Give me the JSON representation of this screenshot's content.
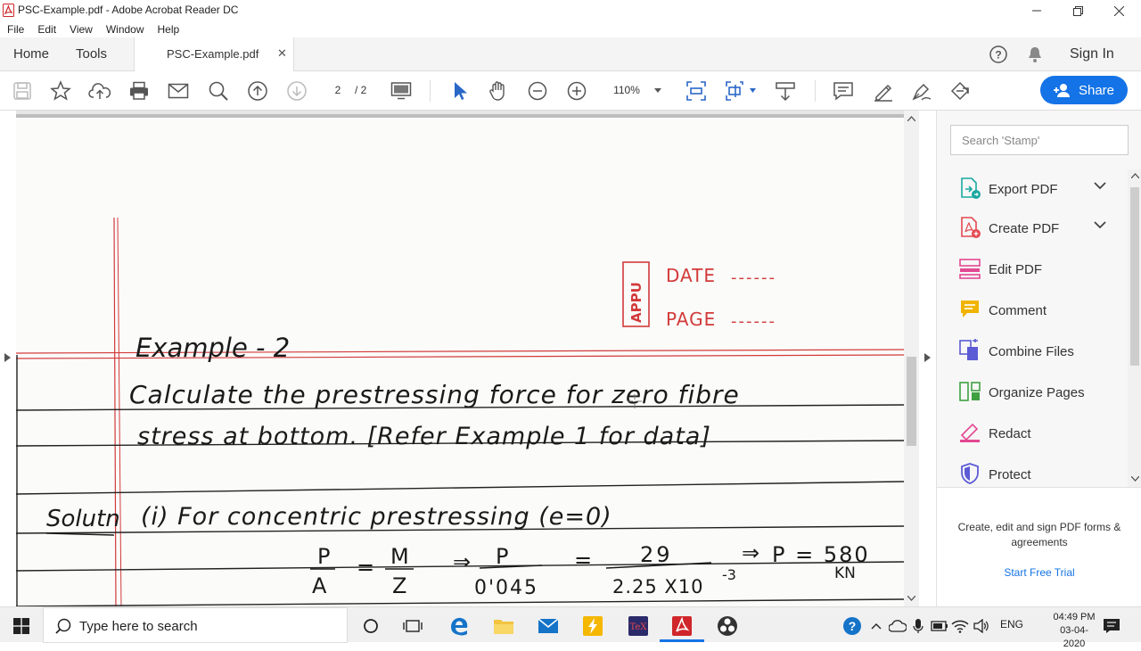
{
  "window": {
    "title": "PSC-Example.pdf - Adobe Acrobat Reader DC"
  },
  "menu": [
    "File",
    "Edit",
    "View",
    "Window",
    "Help"
  ],
  "tabs": {
    "home": "Home",
    "tools": "Tools",
    "document": "PSC-Example.pdf",
    "sign_in": "Sign In"
  },
  "toolbar": {
    "current_page": "2",
    "total_pages": "/ 2",
    "zoom": "110%",
    "share_label": "Share"
  },
  "document": {
    "stamp": {
      "brand": "APPU",
      "date_label": "DATE",
      "date_blank": "------",
      "page_label": "PAGE",
      "page_blank": "------"
    },
    "heading": "Example - 2",
    "line1": "Calculate the prestressing force for zero fibre",
    "line2": "stress at bottom. [Refer Example 1 for data]",
    "solution_label": "Solutn",
    "solution_text": "(i) For concentric prestressing (e=0)",
    "eq": {
      "lhs_num": "P",
      "lhs_den": "A",
      "eq1": "=",
      "m_num": "M",
      "m_den": "Z",
      "implies1": "⇒",
      "p_num": "P",
      "p_den": "0'045",
      "eq2": "=",
      "r_num": "29",
      "r_den": "2.25 X10",
      "r_exp": "-3",
      "implies2": "⇒",
      "result": "P = 580",
      "unit": "KN"
    }
  },
  "right_panel": {
    "search_placeholder": "Search 'Stamp'",
    "tools": [
      {
        "label": "Export PDF",
        "icon": "export-pdf-icon",
        "color": "#1aa8a0"
      },
      {
        "label": "Create PDF",
        "icon": "create-pdf-icon",
        "color": "#e34850"
      },
      {
        "label": "Edit PDF",
        "icon": "edit-pdf-icon",
        "color": "#e34892"
      },
      {
        "label": "Comment",
        "icon": "comment-icon",
        "color": "#f0b400"
      },
      {
        "label": "Combine Files",
        "icon": "combine-files-icon",
        "color": "#5b5bd6"
      },
      {
        "label": "Organize Pages",
        "icon": "organize-pages-icon",
        "color": "#3fa142"
      },
      {
        "label": "Redact",
        "icon": "redact-icon",
        "color": "#e34892"
      },
      {
        "label": "Protect",
        "icon": "protect-icon",
        "color": "#5b5bd6"
      }
    ],
    "promo_text": "Create, edit and sign PDF forms & agreements",
    "promo_link": "Start Free Trial"
  },
  "taskbar": {
    "search_placeholder": "Type here to search",
    "language": "ENG",
    "time": "04:49 PM",
    "date": "03-04-2020"
  },
  "colors": {
    "accent": "#1473e6",
    "ink": "#1a1a1a",
    "margin_red": "#d23a3a"
  }
}
